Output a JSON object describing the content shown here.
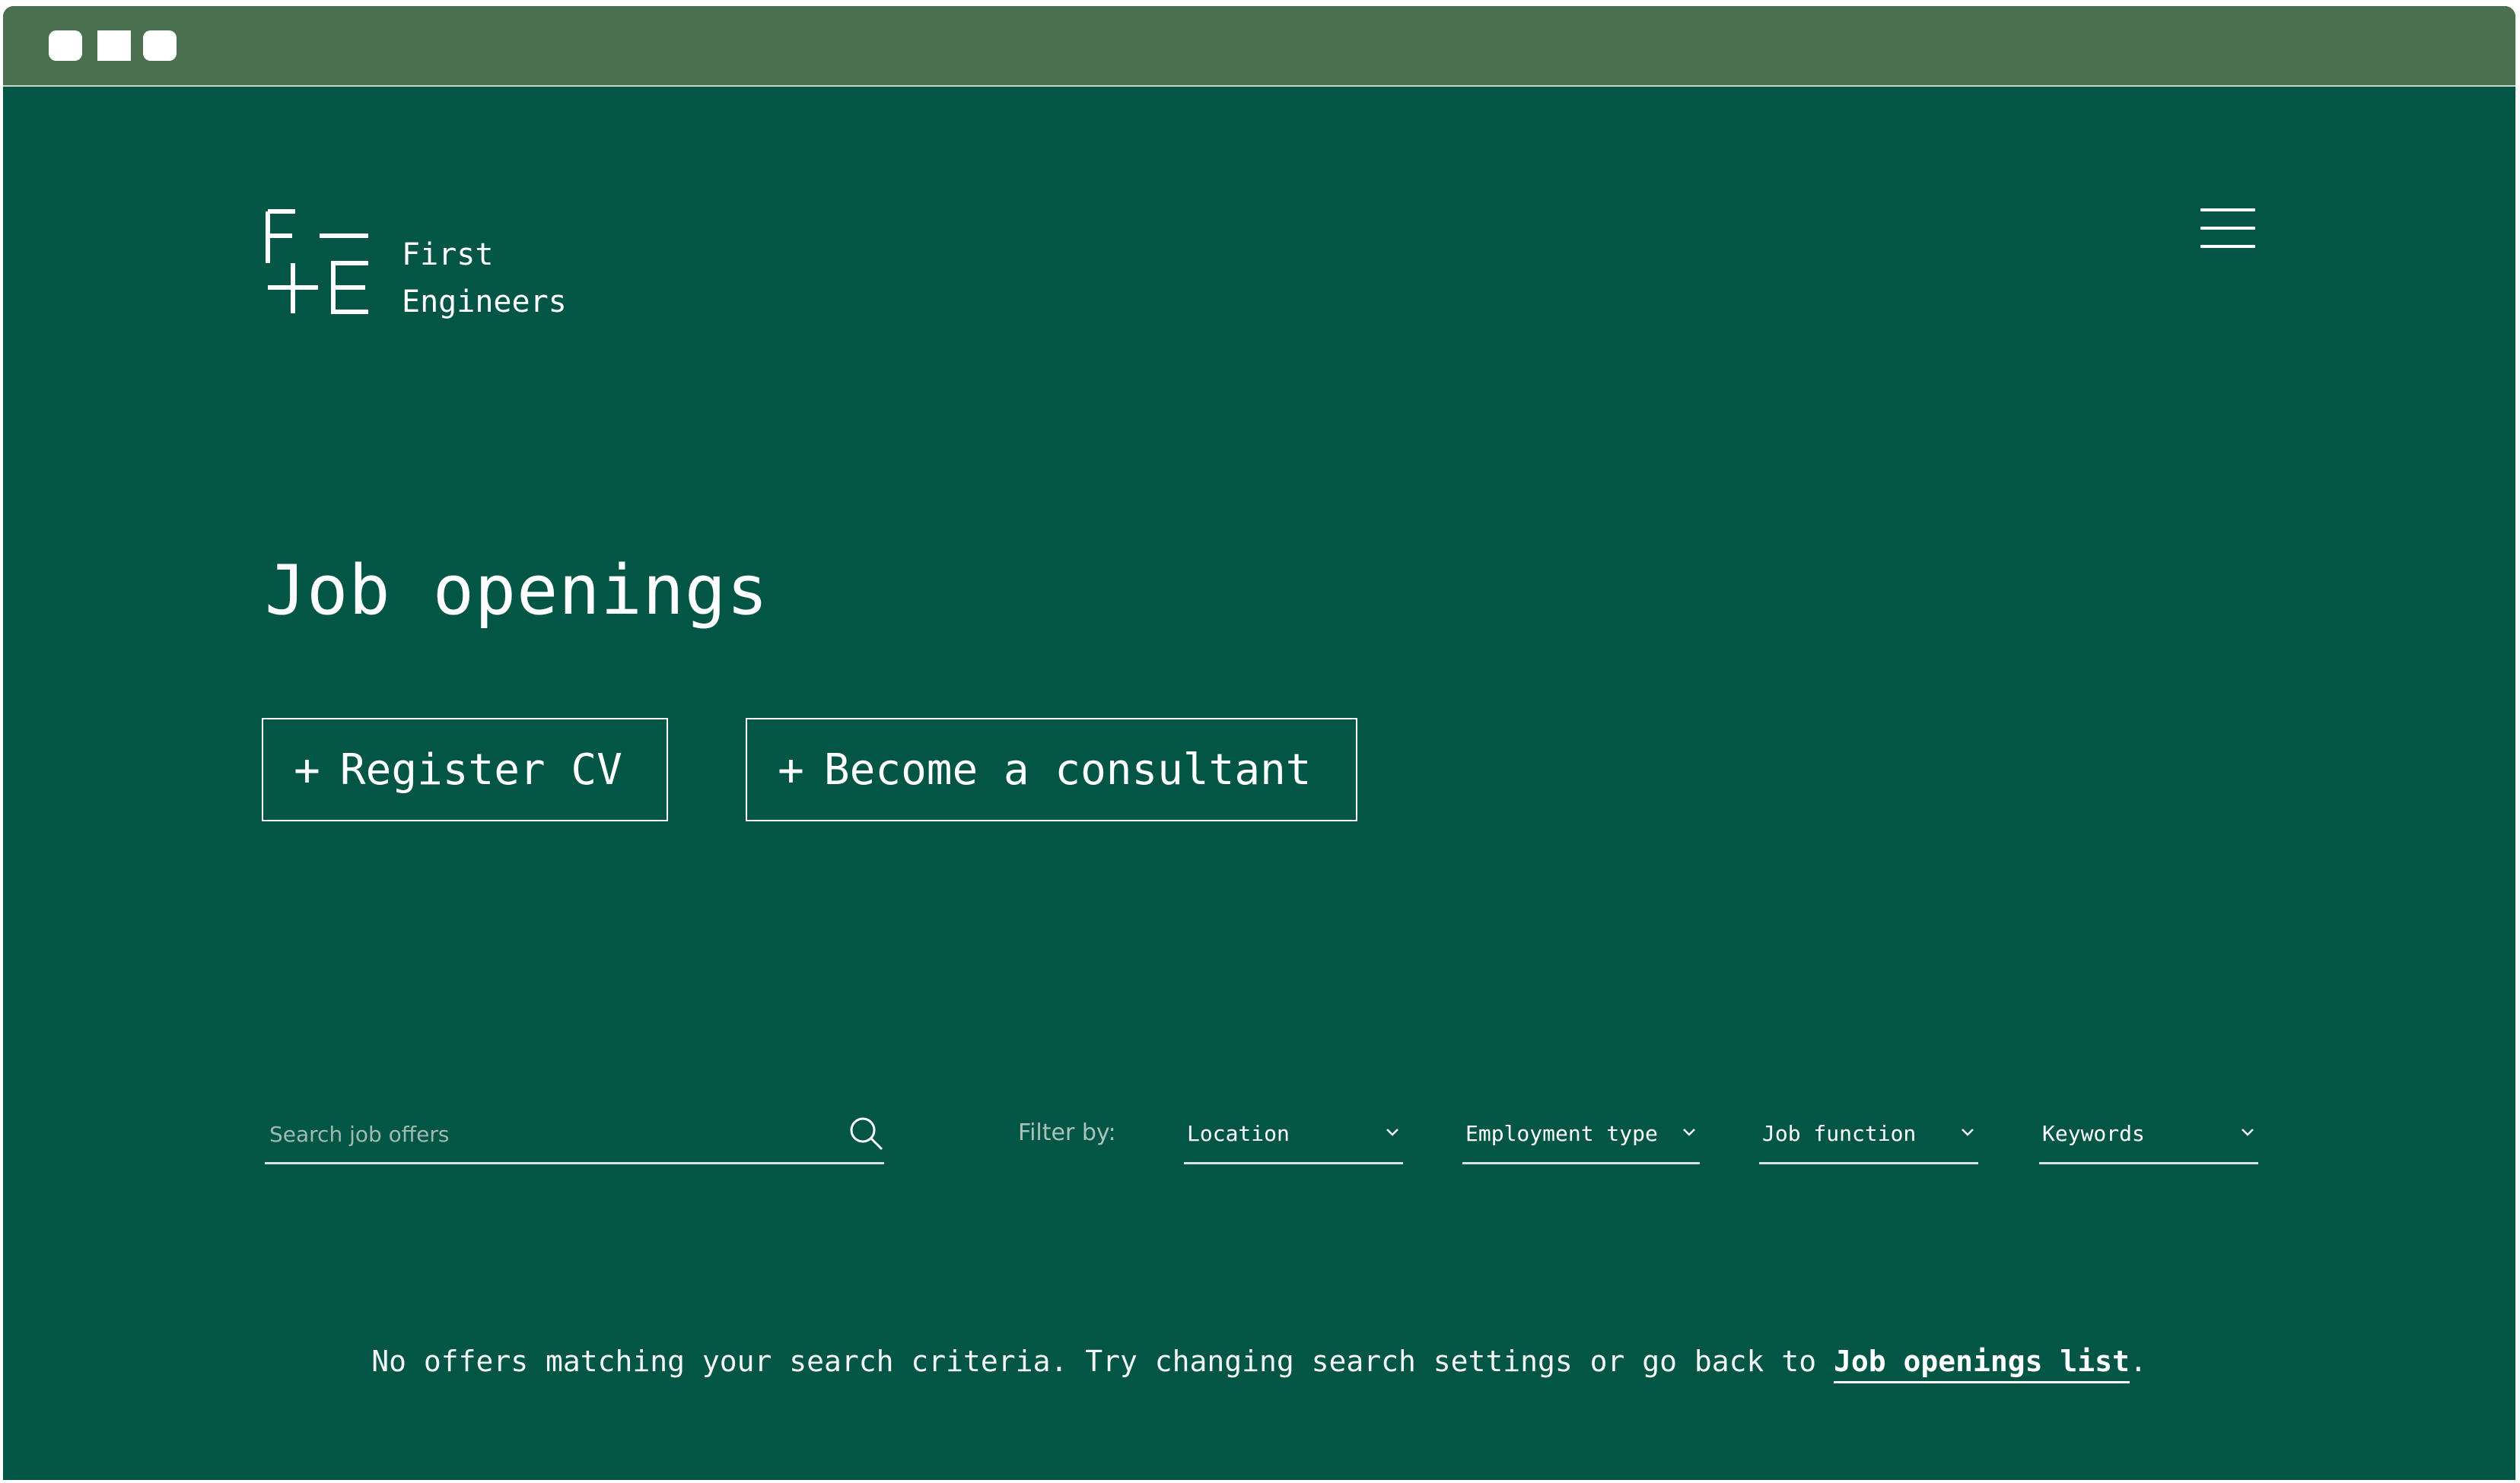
{
  "window": {
    "controls": [
      "dot-1",
      "dot-2",
      "dot-3"
    ]
  },
  "header": {
    "brand_line1": "First",
    "brand_line2": "Engineers",
    "menu_icon": "hamburger-icon"
  },
  "page": {
    "title": "Job openings"
  },
  "actions": {
    "register_cv": "Register CV",
    "become_consultant": "Become a consultant",
    "plus_icon": "+"
  },
  "search": {
    "placeholder": "Search job offers",
    "value": "",
    "icon": "search-icon"
  },
  "filters": {
    "label": "Filter by:",
    "location": "Location",
    "employment_type": "Employment type",
    "job_function": "Job function",
    "keywords": "Keywords"
  },
  "results": {
    "empty_message": "No offers matching your search criteria. Try changing search settings or go back to ",
    "link_text": "Job openings list",
    "suffix": "."
  },
  "colors": {
    "background": "#035645",
    "titlebar": "#4a7050",
    "text": "#ffffff"
  }
}
